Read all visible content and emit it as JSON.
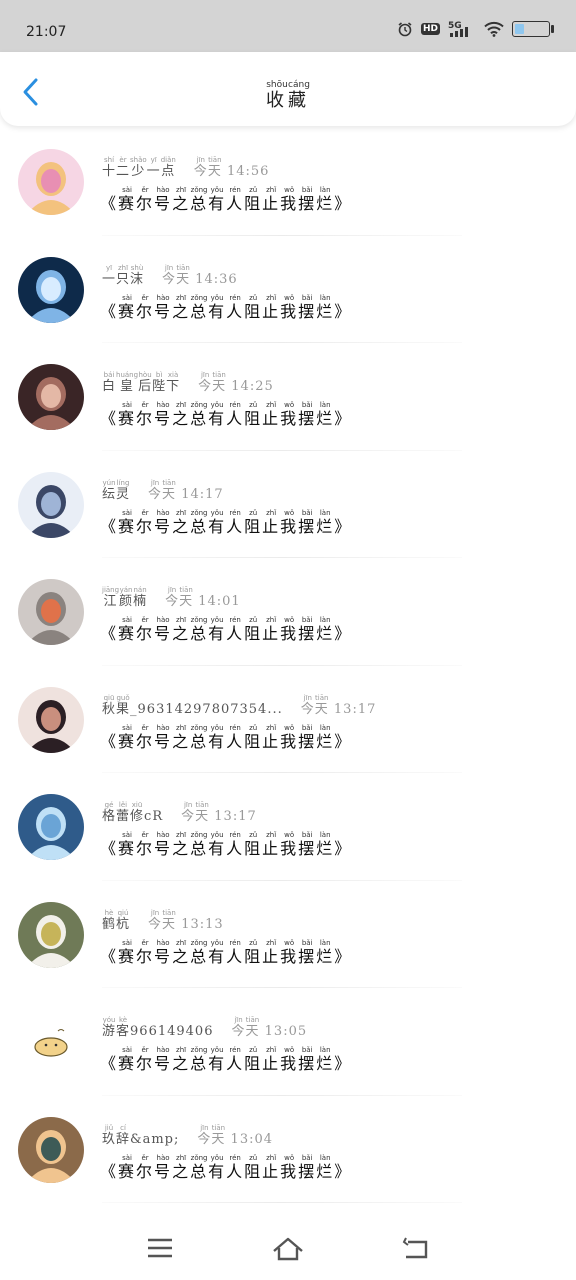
{
  "status_bar": {
    "time": "21:07",
    "hd": "HD",
    "net": "5G",
    "battery_level": 0.3,
    "battery_color": "#8fc7ef"
  },
  "header": {
    "title_chars": [
      [
        "收",
        "shōu"
      ],
      [
        "藏",
        "cáng"
      ]
    ],
    "back_icon": "chevron-left-icon",
    "accent": "#2a8fe0"
  },
  "message_template": [
    [
      "《",
      ""
    ],
    [
      "赛",
      "sài"
    ],
    [
      "尔",
      "ěr"
    ],
    [
      "号",
      "hào"
    ],
    [
      "之",
      "zhī"
    ],
    [
      "总",
      "zǒng"
    ],
    [
      "有",
      "yǒu"
    ],
    [
      "人",
      "rén"
    ],
    [
      "阻",
      "zǔ"
    ],
    [
      "止",
      "zhǐ"
    ],
    [
      "我",
      "wǒ"
    ],
    [
      "摆",
      "bǎi"
    ],
    [
      "烂",
      "làn"
    ],
    [
      "》",
      ""
    ]
  ],
  "items": [
    {
      "name": [
        [
          "十",
          "shí"
        ],
        [
          "二",
          "èr"
        ],
        [
          "少",
          "shǎo"
        ],
        [
          "一",
          "yī"
        ],
        [
          "点",
          "diǎn"
        ]
      ],
      "time_prefix": [
        [
          "今",
          "jīn"
        ],
        [
          "天",
          "tiān"
        ]
      ],
      "time": "14:56"
    },
    {
      "name": [
        [
          "一",
          "yī"
        ],
        [
          "只",
          "zhī"
        ],
        [
          "沫",
          "shù"
        ]
      ],
      "time_prefix": [
        [
          "今",
          "jīn"
        ],
        [
          "天",
          "tiān"
        ]
      ],
      "time": "14:36"
    },
    {
      "name": [
        [
          "白",
          "bái"
        ],
        [
          "皇",
          "huáng"
        ],
        [
          "后",
          "hòu"
        ],
        [
          "陛",
          "bì"
        ],
        [
          "下",
          "xià"
        ]
      ],
      "time_prefix": [
        [
          "今",
          "jīn"
        ],
        [
          "天",
          "tiān"
        ]
      ],
      "time": "14:25"
    },
    {
      "name": [
        [
          "纭",
          "yún"
        ],
        [
          "灵",
          "líng"
        ]
      ],
      "time_prefix": [
        [
          "今",
          "jīn"
        ],
        [
          "天",
          "tiān"
        ]
      ],
      "time": "14:17"
    },
    {
      "name": [
        [
          "江",
          "jiāng"
        ],
        [
          "颜",
          "yán"
        ],
        [
          "楠",
          "nán"
        ]
      ],
      "time_prefix": [
        [
          "今",
          "jīn"
        ],
        [
          "天",
          "tiān"
        ]
      ],
      "time": "14:01"
    },
    {
      "name": [
        [
          "秋",
          "qiū"
        ],
        [
          "果",
          "guǒ"
        ],
        [
          "_96314297807354...",
          ""
        ]
      ],
      "time_prefix": [
        [
          "今",
          "jīn"
        ],
        [
          "天",
          "tiān"
        ]
      ],
      "time": "13:17"
    },
    {
      "name": [
        [
          "格",
          "gé"
        ],
        [
          "蕾",
          "lěi"
        ],
        [
          "修",
          "xiū"
        ],
        [
          "cR",
          ""
        ]
      ],
      "time_prefix": [
        [
          "今",
          "jīn"
        ],
        [
          "天",
          "tiān"
        ]
      ],
      "time": "13:17"
    },
    {
      "name": [
        [
          "鹤",
          "hè"
        ],
        [
          "杭",
          "qiú"
        ]
      ],
      "time_prefix": [
        [
          "今",
          "jīn"
        ],
        [
          "天",
          "tiān"
        ]
      ],
      "time": "13:13"
    },
    {
      "name": [
        [
          "游",
          "yóu"
        ],
        [
          "客",
          "kè"
        ],
        [
          "966149406",
          ""
        ]
      ],
      "time_prefix": [
        [
          "今",
          "jīn"
        ],
        [
          "天",
          "tiān"
        ]
      ],
      "time": "13:05"
    },
    {
      "name": [
        [
          "玖",
          "jiǔ"
        ],
        [
          "辞",
          "cí"
        ],
        [
          "&amp;",
          ""
        ]
      ],
      "time_prefix": [
        [
          "今",
          "jīn"
        ],
        [
          "天",
          "tiān"
        ]
      ],
      "time": "13:04"
    }
  ],
  "nav": {
    "menu_icon": "menu-icon",
    "home_icon": "home-icon",
    "back_icon": "back-icon"
  }
}
